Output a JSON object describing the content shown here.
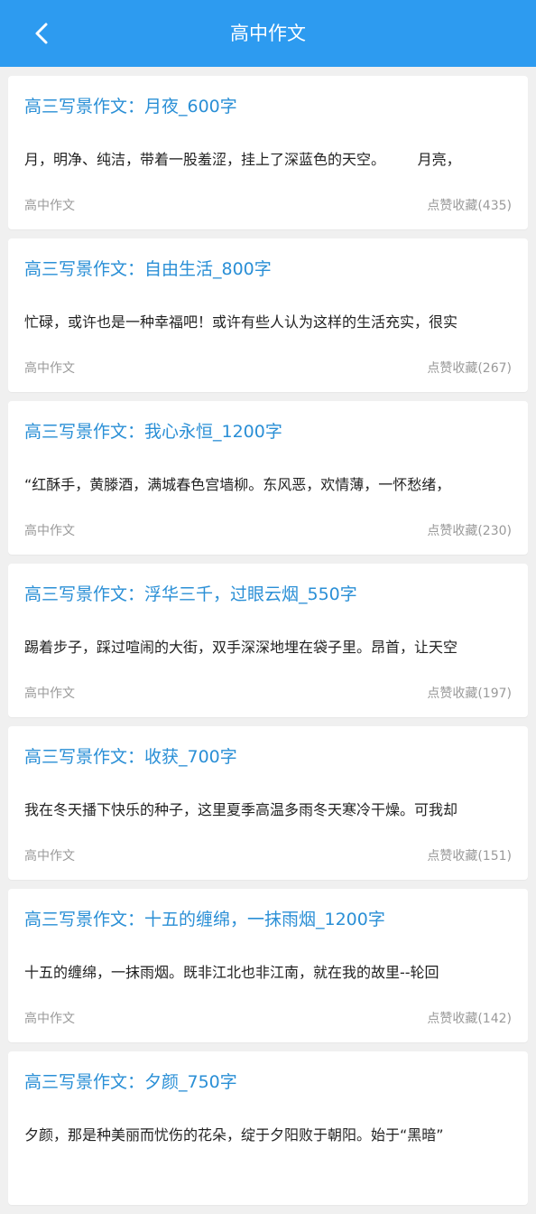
{
  "header": {
    "title": "高中作文",
    "back_icon": "chevron-left-icon"
  },
  "colors": {
    "header_bg": "#2d9bf0",
    "title_blue": "#2a8fd6",
    "page_bg": "#f0f0f0"
  },
  "articles": [
    {
      "title": "高三写景作文：月夜_600字",
      "excerpt": "月，明净、纯洁，带着一股羞涩，挂上了深蓝色的天空。       月亮，",
      "category": "高中作文",
      "stats": "点赞收藏(435)"
    },
    {
      "title": "高三写景作文：自由生活_800字",
      "excerpt": "忙碌，或许也是一种幸福吧！或许有些人认为这样的生活充实，很实",
      "category": "高中作文",
      "stats": "点赞收藏(267)"
    },
    {
      "title": "高三写景作文：我心永恒_1200字",
      "excerpt": "“红酥手，黄滕酒，满城春色宫墙柳。东风恶，欢情薄，一怀愁绪，",
      "category": "高中作文",
      "stats": "点赞收藏(230)"
    },
    {
      "title": "高三写景作文：浮华三千，过眼云烟_550字",
      "excerpt": "踢着步子，踩过喧闹的大街，双手深深地埋在袋子里。昂首，让天空",
      "category": "高中作文",
      "stats": "点赞收藏(197)"
    },
    {
      "title": "高三写景作文：收获_700字",
      "excerpt": "我在冬天播下快乐的种子，这里夏季高温多雨冬天寒冷干燥。可我却",
      "category": "高中作文",
      "stats": "点赞收藏(151)"
    },
    {
      "title": "高三写景作文：十五的缠绵，一抹雨烟_1200字",
      "excerpt": "十五的缠绵，一抹雨烟。既非江北也非江南，就在我的故里--轮回",
      "category": "高中作文",
      "stats": "点赞收藏(142)"
    },
    {
      "title": "高三写景作文：夕颜_750字",
      "excerpt": "夕颜，那是种美丽而忧伤的花朵，绽于夕阳败于朝阳。始于“黑暗”",
      "category": "",
      "stats": ""
    }
  ]
}
